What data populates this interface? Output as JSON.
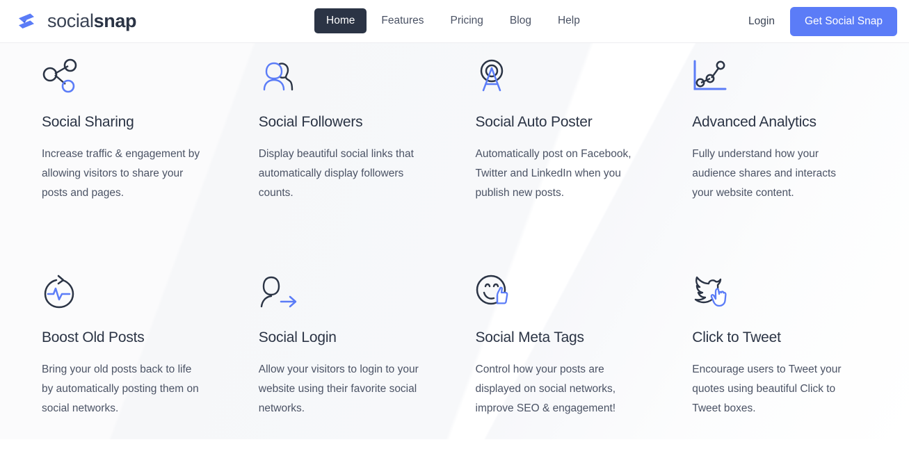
{
  "brand": {
    "name_light": "social",
    "name_bold": "snap",
    "logo_icon": "socialsnap-logo-icon",
    "logo_color": "#5b7cf7"
  },
  "header": {
    "nav": [
      {
        "label": "Home",
        "active": true
      },
      {
        "label": "Features",
        "active": false
      },
      {
        "label": "Pricing",
        "active": false
      },
      {
        "label": "Blog",
        "active": false
      },
      {
        "label": "Help",
        "active": false
      }
    ],
    "login_label": "Login",
    "cta_label": "Get Social Snap",
    "active_color": "#2b3445",
    "cta_color": "#5b7cf7"
  },
  "features": [
    {
      "icon": "share-nodes-icon",
      "title": "Social Sharing",
      "desc": "Increase traffic & engagement by allowing visitors to share your posts and pages."
    },
    {
      "icon": "two-people-icon",
      "title": "Social Followers",
      "desc": "Display beautiful social links that automatically display followers counts."
    },
    {
      "icon": "broadcast-tower-icon",
      "title": "Social Auto Poster",
      "desc": "Automatically post on Facebook, Twitter and LinkedIn when you publish new posts."
    },
    {
      "icon": "line-chart-icon",
      "title": "Advanced Analytics",
      "desc": "Fully understand how your audience shares and interacts your website content."
    },
    {
      "icon": "refresh-pulse-icon",
      "title": "Boost Old Posts",
      "desc": "Bring your old posts back to life by automatically posting them on social networks."
    },
    {
      "icon": "person-arrow-icon",
      "title": "Social Login",
      "desc": "Allow your visitors to login to your website using their favorite social networks."
    },
    {
      "icon": "smiley-thumbsup-icon",
      "title": "Social Meta Tags",
      "desc": "Control how your posts are displayed on social networks, improve SEO & engagement!"
    },
    {
      "icon": "twitter-bird-click-icon",
      "title": "Click to Tweet",
      "desc": "Encourage users to Tweet your quotes using beautiful Click to Tweet boxes."
    }
  ],
  "colors": {
    "accent_blue": "#5b7cf7",
    "icon_dark": "#2b3445",
    "text_dark": "#2b3445",
    "text_body": "#4b5365"
  }
}
